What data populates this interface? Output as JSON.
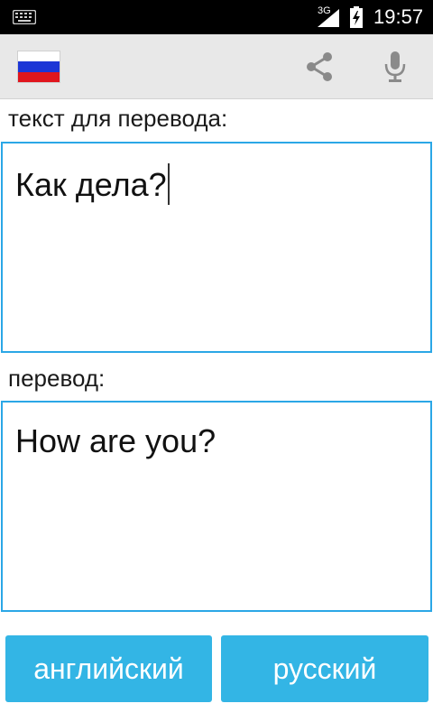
{
  "status_bar": {
    "network": "3G",
    "time": "19:57",
    "icons": [
      "keyboard-icon",
      "signal-icon",
      "battery-charging-icon"
    ]
  },
  "action_bar": {
    "flag": "russian-flag",
    "actions": [
      "share-icon",
      "microphone-icon"
    ],
    "colors": {
      "background": "#e8e8e8",
      "icon": "#8a8a8a"
    }
  },
  "source": {
    "label": "текст для перевода:",
    "text": "Как дела?"
  },
  "target": {
    "label": "перевод:",
    "text": "How are you?"
  },
  "buttons": {
    "from_language": "английский",
    "to_language": "русский"
  },
  "colors": {
    "accent": "#2ba7e6",
    "button": "#33b5e5",
    "status_bar": "#000000"
  }
}
